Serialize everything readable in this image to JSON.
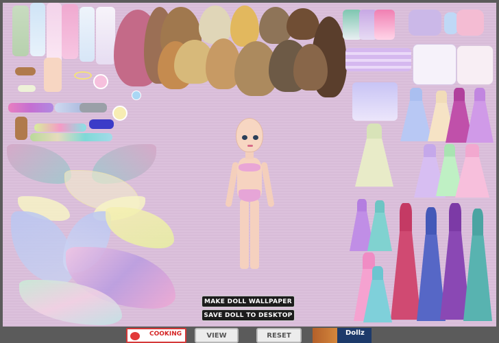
{
  "buttons": {
    "make_wallpaper": "MAKE DOLL WALLPAPER",
    "save_desktop": "SAVE DOLL TO DESKTOP",
    "view": "VIEW",
    "reset": "RESET"
  },
  "ads": {
    "cooking": "COOKING",
    "dollz": "Dollz"
  },
  "colors": {
    "background": "#d9bdd9",
    "frame": "#5b5b5b",
    "skin": "#f7d6c2",
    "underwear": "#e6a5d7"
  },
  "wardrobe": {
    "hair_count": 14,
    "stockings_count": 6,
    "tops_count": 8,
    "skirts_count": 4,
    "short_dresses_count": 8,
    "gowns_count": 7,
    "wings_count": 10
  }
}
